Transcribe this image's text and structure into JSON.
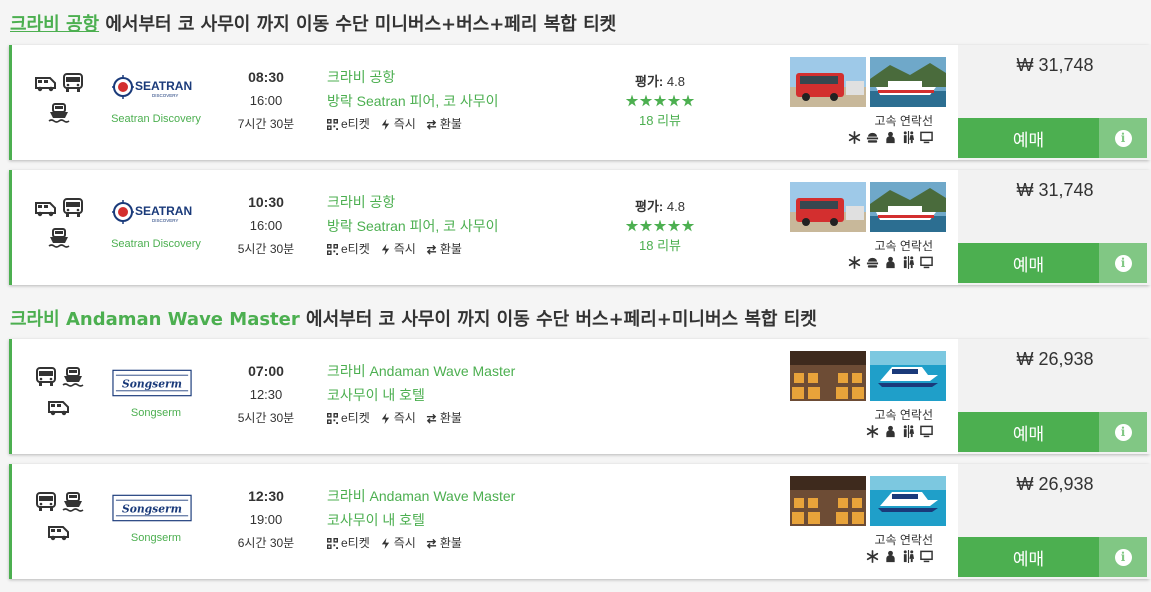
{
  "sections": [
    {
      "title_prefix_link": "크라비 공항",
      "title_rest": " 에서부터 코 사무이 까지 이동 수단 미니버스+버스+페리 복합 티켓",
      "trips": [
        {
          "operator": "Seatran Discovery",
          "logo_text": "SEATRAN",
          "logo_sub": "DISCOVERY",
          "depart": "08:30",
          "arrive": "16:00",
          "duration": "7시간 30분",
          "from": "크라비 공항",
          "to": "방락 Seatran 피어, 코 사무이",
          "rating_label": "평가:",
          "rating_value": "4.8",
          "reviews": "18 리뷰",
          "vehicle_class": "고속 연락선",
          "amenities": [
            "snowflake-icon",
            "food-icon",
            "person-icon",
            "restroom-icon",
            "tv-icon"
          ],
          "price": "₩ 31,748",
          "buy_label": "예매"
        },
        {
          "operator": "Seatran Discovery",
          "logo_text": "SEATRAN",
          "logo_sub": "DISCOVERY",
          "depart": "10:30",
          "arrive": "16:00",
          "duration": "5시간 30분",
          "from": "크라비 공항",
          "to": "방락 Seatran 피어, 코 사무이",
          "rating_label": "평가:",
          "rating_value": "4.8",
          "reviews": "18 리뷰",
          "vehicle_class": "고속 연락선",
          "amenities": [
            "snowflake-icon",
            "food-icon",
            "person-icon",
            "restroom-icon",
            "tv-icon"
          ],
          "price": "₩ 31,748",
          "buy_label": "예매"
        }
      ]
    },
    {
      "title_prefix": "크라비 ",
      "title_highlight": "Andaman Wave Master",
      "title_rest": " 에서부터 코 사무이 까지 이동 수단 버스+페리+미니버스 복합 티켓",
      "trips": [
        {
          "operator": "Songserm",
          "logo_text": "Songserm",
          "depart": "07:00",
          "arrive": "12:30",
          "duration": "5시간 30분",
          "from": "크라비 Andaman Wave Master",
          "to": "코사무이 내 호텔",
          "vehicle_class": "고속 연락선",
          "amenities": [
            "snowflake-icon",
            "person-icon",
            "restroom-icon",
            "tv-icon"
          ],
          "price": "₩ 26,938",
          "buy_label": "예매"
        },
        {
          "operator": "Songserm",
          "logo_text": "Songserm",
          "depart": "12:30",
          "arrive": "19:00",
          "duration": "6시간 30분",
          "from": "크라비 Andaman Wave Master",
          "to": "코사무이 내 호텔",
          "vehicle_class": "고속 연락선",
          "amenities": [
            "snowflake-icon",
            "person-icon",
            "restroom-icon",
            "tv-icon"
          ],
          "price": "₩ 26,938",
          "buy_label": "예매"
        }
      ]
    }
  ],
  "features": {
    "eticket": "e티켓",
    "instant": "즉시",
    "refund": "환불"
  },
  "colors": {
    "accent": "#4caf50",
    "accent_light": "#81c784"
  }
}
